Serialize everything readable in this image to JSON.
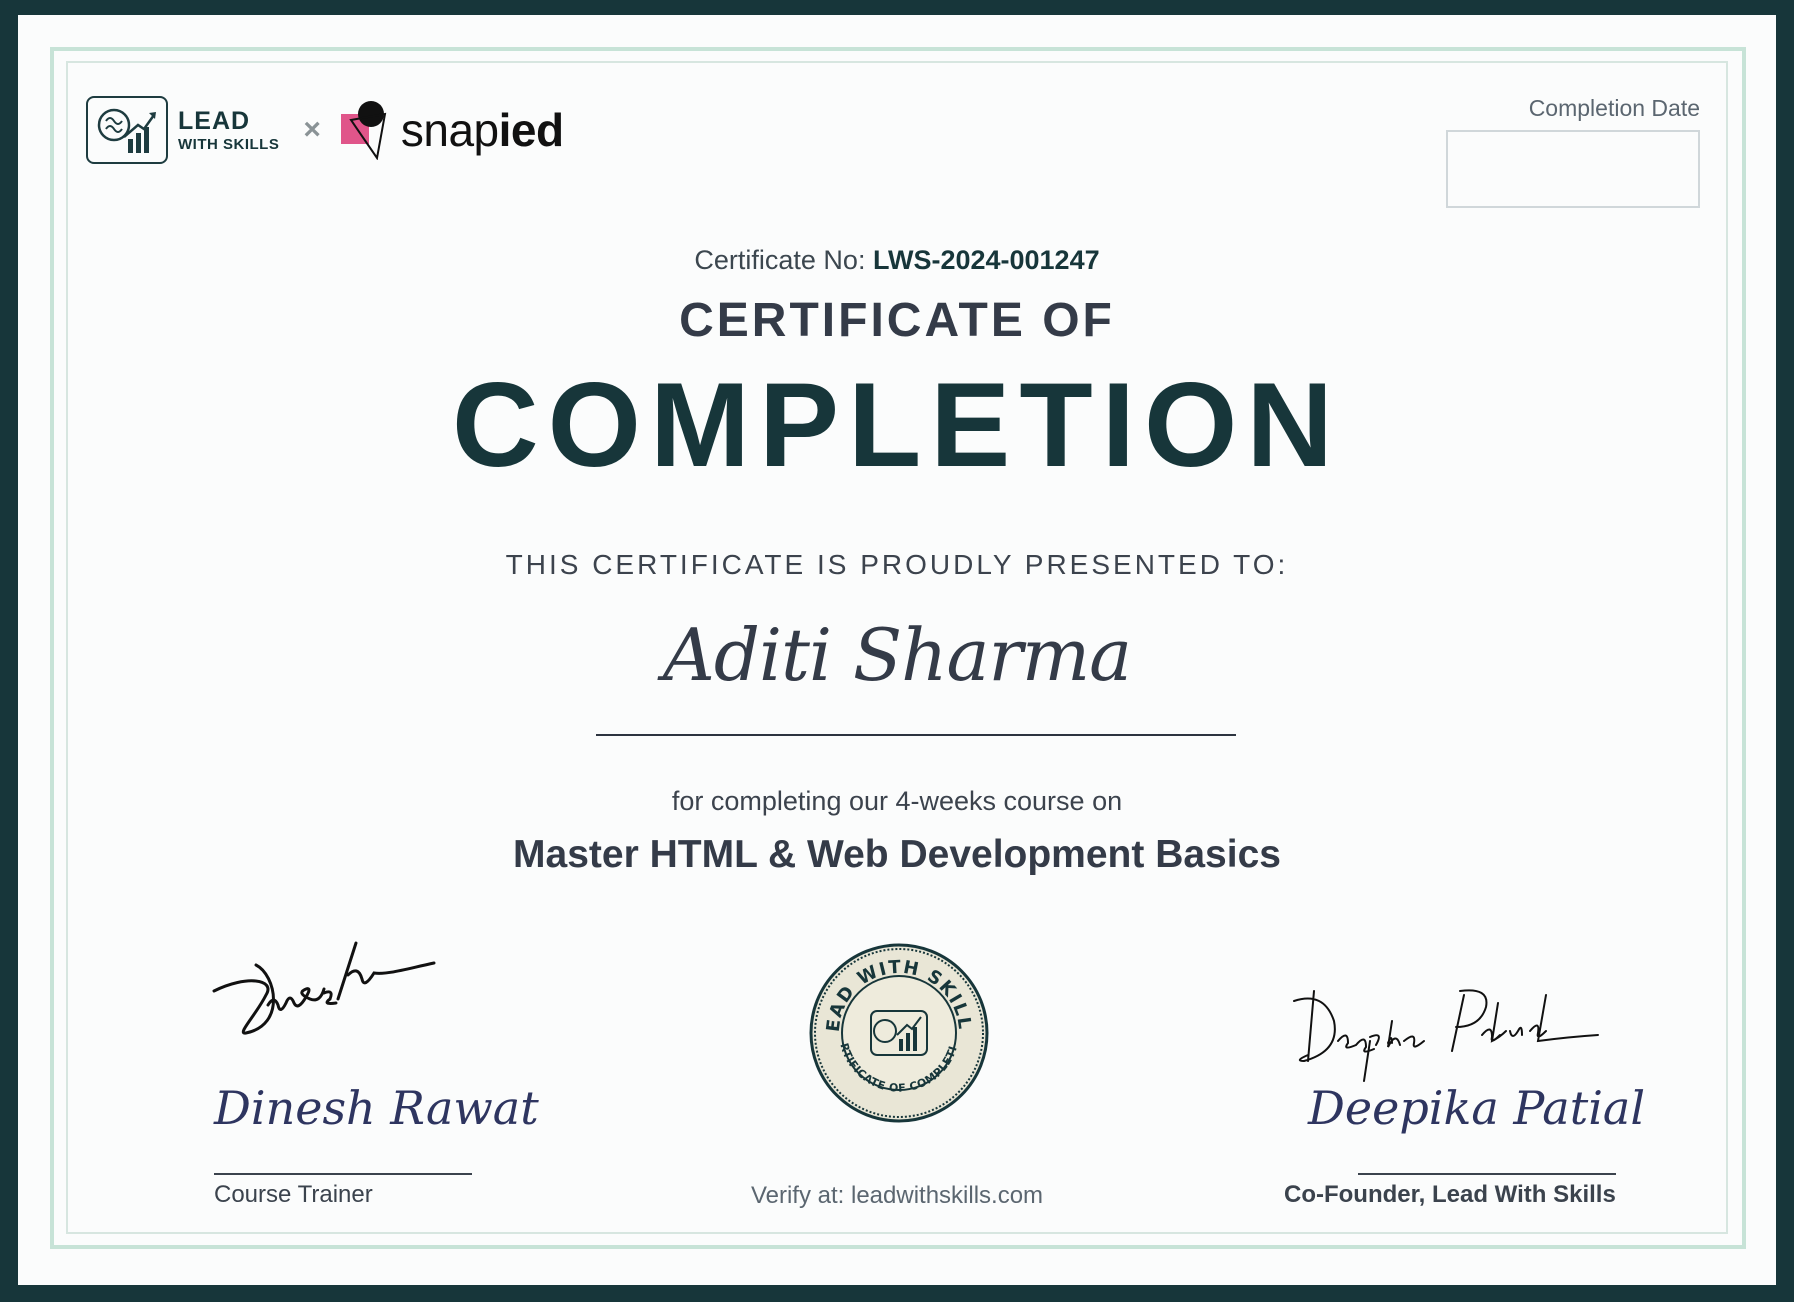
{
  "header": {
    "logo_lead": "LEAD",
    "logo_with_skills": "WITH SKILLS",
    "separator": "×",
    "partner_prefix": "snap",
    "partner_suffix": "ied",
    "completion_date_label": "Completion Date",
    "completion_date_value": ""
  },
  "certificate": {
    "number_label": "Certificate No:",
    "number": "LWS-2024-001247",
    "title_line1": "CERTIFICATE OF",
    "title_line2": "COMPLETION",
    "presented_to": "THIS CERTIFICATE IS PROUDLY PRESENTED TO:",
    "recipient": "Aditi Sharma",
    "for_text": "for completing our 4-weeks course on",
    "course": "Master HTML & Web Development Basics"
  },
  "signatories": {
    "left": {
      "name": "Dinesh Rawat",
      "role": "Course Trainer"
    },
    "right": {
      "name": "Deepika Patial",
      "role": "Co-Founder, Lead With Skills"
    }
  },
  "seal": {
    "top_text": "LEAD WITH SKILLS",
    "bottom_text": "CERTIFICATE OF COMPLETION"
  },
  "footer": {
    "verify": "Verify at: leadwithskills.com"
  },
  "colors": {
    "primary": "#17363a",
    "accent_pink": "#e0558a",
    "border_mint": "#c7e3d7"
  }
}
